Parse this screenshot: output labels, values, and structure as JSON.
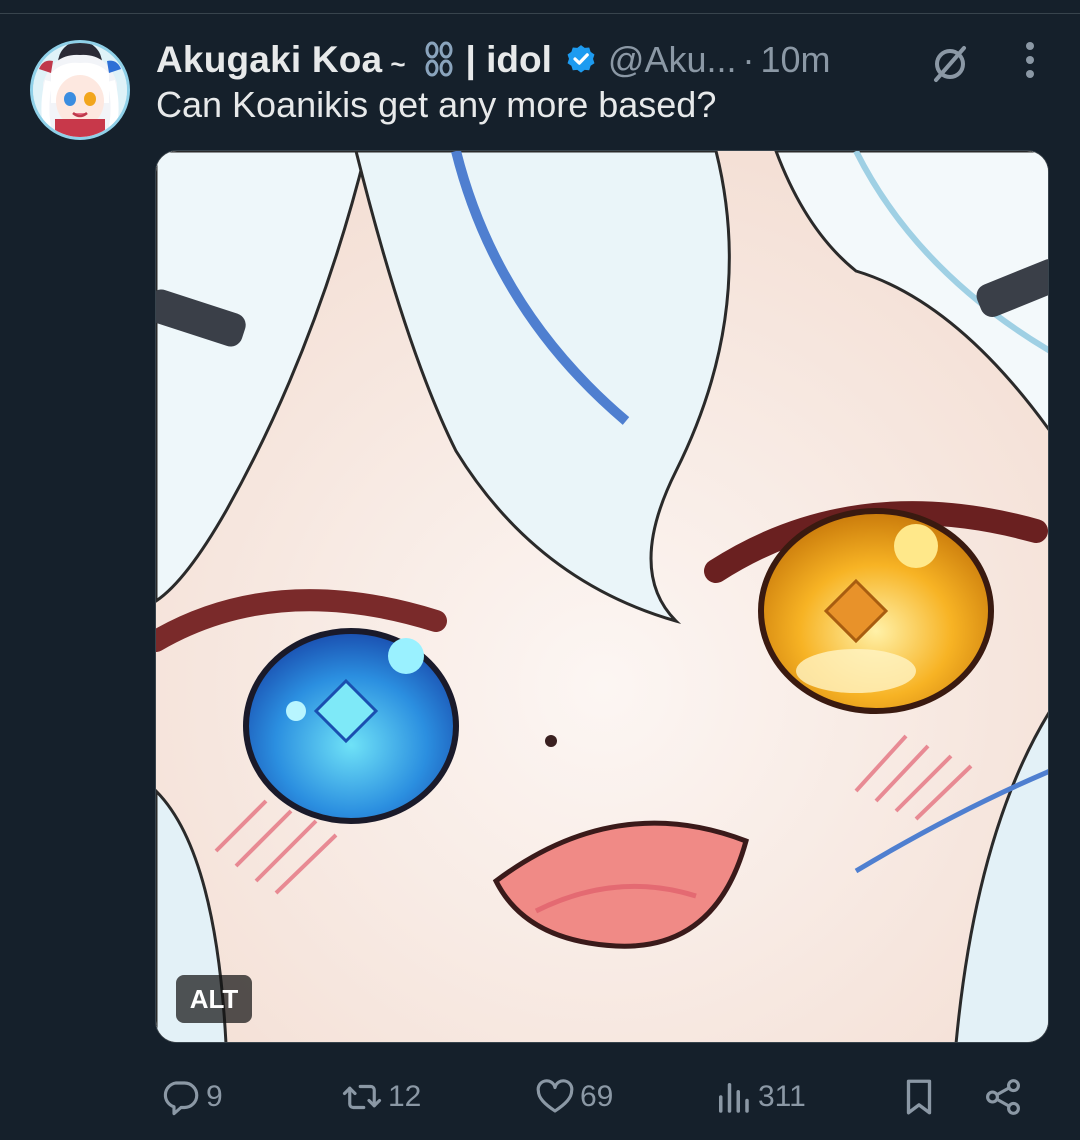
{
  "tweet": {
    "display_name": "Akugaki Koa",
    "name_separator": "| idol",
    "handle": "@Aku...",
    "dot": "·",
    "time": "10m",
    "text": "Can Koanikis get any more based?",
    "media": {
      "alt_badge": "ALT"
    },
    "actions": {
      "replies": "9",
      "reposts": "12",
      "likes": "69",
      "views": "311"
    }
  },
  "icons": {
    "verified": "verified-badge-icon",
    "chain": "chain-link-icon",
    "tilde": "wave-tilde-icon",
    "muted": "muted-circle-slash-icon",
    "more": "more-vertical-icon",
    "reply": "reply-icon",
    "repost": "repost-icon",
    "like": "heart-icon",
    "views": "views-chart-icon",
    "bookmark": "bookmark-icon",
    "share": "share-icon"
  },
  "colors": {
    "background": "#15202b",
    "text": "#e7e9ea",
    "secondary": "#8b98a5",
    "verified": "#1d9bf0",
    "divider": "#38444d"
  }
}
